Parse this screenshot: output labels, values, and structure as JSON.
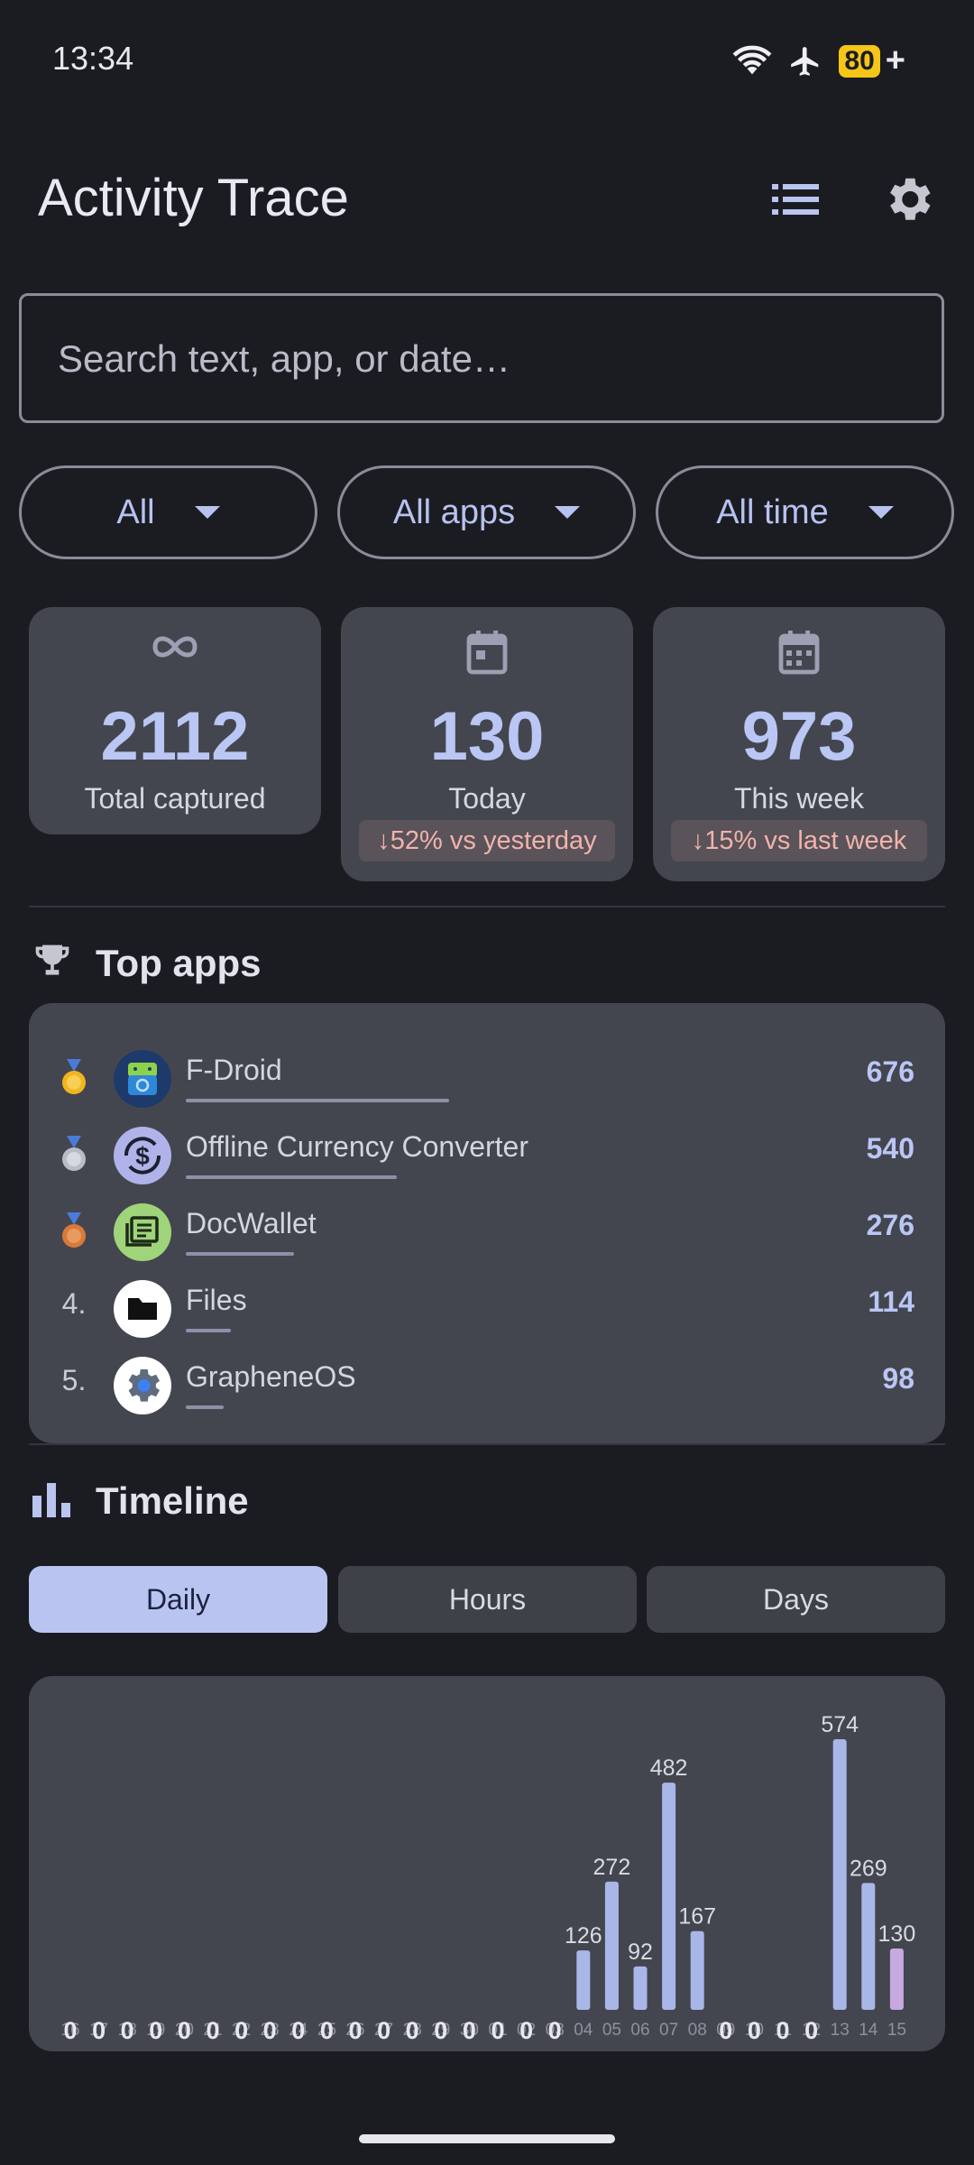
{
  "status_bar": {
    "time": "13:34",
    "battery": "80"
  },
  "header": {
    "title": "Activity Trace"
  },
  "search": {
    "placeholder": "Search text, app, or date…"
  },
  "filters": [
    "All",
    "All apps",
    "All time"
  ],
  "stats": {
    "total": {
      "value": "2112",
      "label": "Total captured"
    },
    "today": {
      "value": "130",
      "label": "Today",
      "delta": "↓52% vs yesterday"
    },
    "week": {
      "value": "973",
      "label": "This week",
      "delta": "↓15% vs last week"
    }
  },
  "top_apps": {
    "title": "Top apps",
    "items": [
      {
        "rank": "medal-gold",
        "name": "F-Droid",
        "count": "676",
        "share": 1.0,
        "icon": "fdroid-icon"
      },
      {
        "rank": "medal-silver",
        "name": "Offline Currency Converter",
        "count": "540",
        "share": 0.8,
        "icon": "currency-converter-icon"
      },
      {
        "rank": "medal-bronze",
        "name": "DocWallet",
        "count": "276",
        "share": 0.41,
        "icon": "docwallet-icon"
      },
      {
        "rank": "4.",
        "name": "Files",
        "count": "114",
        "share": 0.17,
        "icon": "folder-icon"
      },
      {
        "rank": "5.",
        "name": "GrapheneOS",
        "count": "98",
        "share": 0.145,
        "icon": "gear-icon"
      }
    ]
  },
  "timeline": {
    "title": "Timeline",
    "tabs": [
      "Daily",
      "Hours",
      "Days"
    ],
    "active_tab": "Daily"
  },
  "chart_data": {
    "type": "bar",
    "categories": [
      "16",
      "17",
      "18",
      "19",
      "20",
      "21",
      "22",
      "23",
      "24",
      "25",
      "26",
      "27",
      "28",
      "29",
      "30",
      "01",
      "02",
      "03",
      "04",
      "05",
      "06",
      "07",
      "08",
      "09",
      "10",
      "11",
      "12",
      "13",
      "14",
      "15"
    ],
    "values": [
      0,
      0,
      0,
      0,
      0,
      0,
      0,
      0,
      0,
      0,
      0,
      0,
      0,
      0,
      0,
      0,
      0,
      0,
      126,
      272,
      92,
      482,
      167,
      0,
      0,
      0,
      0,
      574,
      269,
      130
    ],
    "title": "",
    "xlabel": "",
    "ylabel": "",
    "ylim": [
      0,
      574
    ],
    "highlight_last": true,
    "colors": {
      "bar": "#a9b6e8",
      "highlight": "#c7a8e0",
      "label": "#d8dae4",
      "tick": "#8d90a0"
    }
  }
}
